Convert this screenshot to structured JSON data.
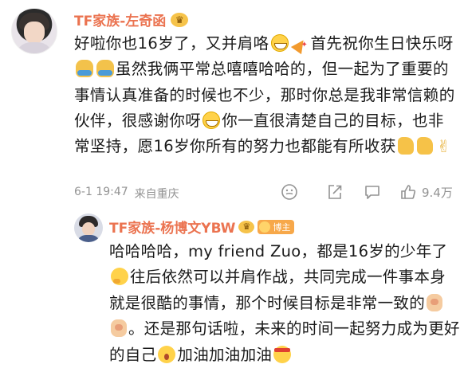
{
  "comment": {
    "username": "TF家族-左奇函",
    "segments": [
      {
        "t": "text",
        "v": "好啦你也16岁了，又并肩咯"
      },
      {
        "t": "icon",
        "icon": "grin-emoji"
      },
      {
        "t": "icon",
        "icon": "party-popper-emoji"
      },
      {
        "t": "text",
        "v": "首先祝你生日快乐呀"
      },
      {
        "t": "icon",
        "icon": "hug-emoji"
      },
      {
        "t": "icon",
        "icon": "hug-emoji"
      },
      {
        "t": "text",
        "v": "虽然我俩平常总嘻嘻哈哈的，但一起为了重要的事情认真准备的时候也不少，那时你总是我非常信赖的伙伴，很感谢你呀"
      },
      {
        "t": "icon",
        "icon": "grin-emoji"
      },
      {
        "t": "text",
        "v": "你一直很清楚自己的目标，也非常坚持，愿16岁你所有的努力也都能有所收获"
      },
      {
        "t": "icon",
        "icon": "thumbs-up-emoji"
      },
      {
        "t": "icon",
        "icon": "thumbs-up-emoji"
      },
      {
        "t": "icon",
        "icon": "victory-hand-emoji"
      }
    ],
    "timestamp": "6-1 19:47",
    "location": "来自重庆",
    "like_count": "9.4万"
  },
  "reply": {
    "username": "TF家族-杨博文YBW",
    "badge_label": "博主",
    "segments": [
      {
        "t": "text",
        "v": "哈哈哈哈，my friend Zuo，都是16岁的少年了"
      },
      {
        "t": "icon",
        "icon": "thinking-emoji"
      },
      {
        "t": "text",
        "v": "往后依然可以并肩作战，共同完成一件事本身就是很酷的事情，那个时候目标是非常一致的"
      },
      {
        "t": "icon",
        "icon": "fist-emoji"
      },
      {
        "t": "icon",
        "icon": "fist-emoji"
      },
      {
        "t": "text",
        "v": "。还是那句话啦，未来的时间一起努力成为更好的自己"
      },
      {
        "t": "icon",
        "icon": "surprised-emoji"
      },
      {
        "t": "text",
        "v": "加油加油加油"
      },
      {
        "t": "icon",
        "icon": "fighting-emoji"
      }
    ]
  },
  "colors": {
    "username": "#eb7350",
    "meta": "#939393",
    "text": "#1a1a1a"
  }
}
